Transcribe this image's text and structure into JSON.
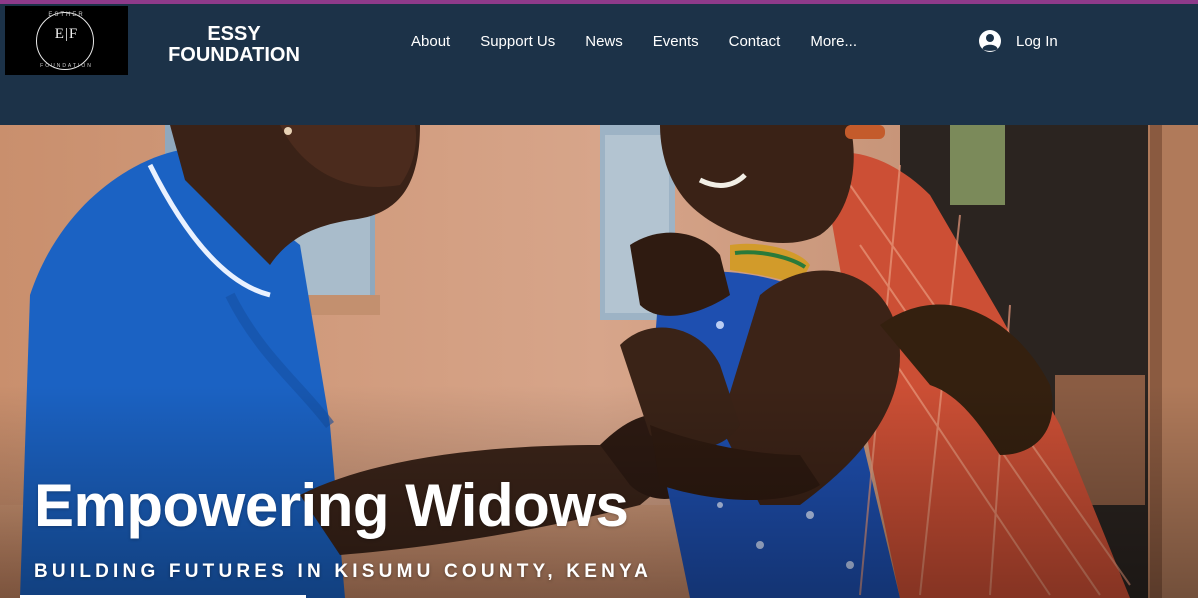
{
  "logo": {
    "letters": "E|F",
    "top_text": "ESTHER",
    "bottom_text": "FOUNDATION"
  },
  "brand": {
    "line1": "ESSY",
    "line2": "FOUNDATION"
  },
  "nav": {
    "items": [
      "About",
      "Support Us",
      "News",
      "Events",
      "Contact",
      "More..."
    ]
  },
  "login": {
    "label": "Log In",
    "icon": "user-avatar-icon"
  },
  "hero": {
    "headline": "Empowering Widows",
    "subheadline": "BUILDING FUTURES IN KISUMU COUNTY, KENYA"
  },
  "colors": {
    "header_bg": "#1c3248",
    "accent_line": "#8e3a8a",
    "text": "#ffffff"
  }
}
